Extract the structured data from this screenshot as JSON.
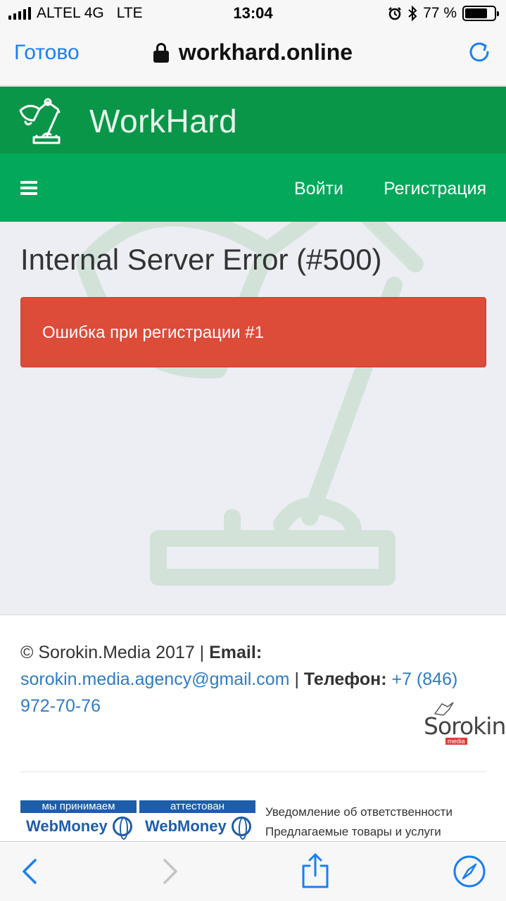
{
  "status_bar": {
    "carrier": "ALTEL 4G",
    "network": "LTE",
    "time": "13:04",
    "battery_percent": "77 %",
    "battery_level": 0.77
  },
  "browser": {
    "done_label": "Готово",
    "url": "workhard.online"
  },
  "site": {
    "brand": "WorkHard",
    "nav": {
      "login": "Войти",
      "register": "Регистрация"
    },
    "colors": {
      "header": "#0a9648",
      "nav": "#03a85a",
      "alert": "#dd4b39",
      "link": "#2f7cc2"
    }
  },
  "content": {
    "error_title": "Internal Server Error (#500)",
    "alert_message": "Ошибка при регистрации #1"
  },
  "footer": {
    "copyright": "© Sorokin.Media 2017 |",
    "email_label": "Email:",
    "email": "sorokin.media.agency@gmail.com",
    "separator": "|",
    "phone_label": "Телефон:",
    "phone": "+7 (846) 972-70-76",
    "agency_logo_name": "Sorokin",
    "agency_logo_sub": "media",
    "webmoney_accept": {
      "top": "мы принимаем",
      "bottom": "WebMoney"
    },
    "webmoney_attested": {
      "top": "аттестован",
      "bottom": "WebMoney"
    },
    "links": [
      "Уведомление об ответственности",
      "Предлагаемые товары и услуги"
    ]
  },
  "icons": [
    "lock-icon",
    "reload-icon",
    "lamp-logo-icon",
    "hamburger-icon",
    "back-icon",
    "forward-icon",
    "share-icon",
    "compass-icon"
  ]
}
